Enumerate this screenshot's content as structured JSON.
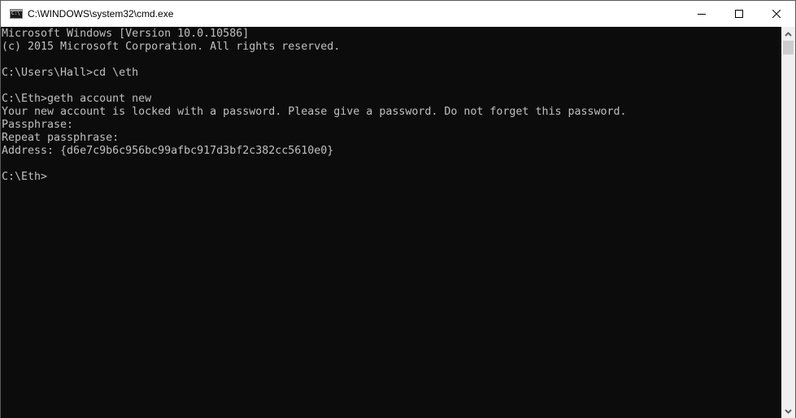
{
  "window": {
    "title": "C:\\WINDOWS\\system32\\cmd.exe",
    "icon": "cmd-icon",
    "controls": {
      "minimize": "minimize-icon",
      "maximize": "maximize-icon",
      "close": "close-icon"
    }
  },
  "console": {
    "lines": [
      "Microsoft Windows [Version 10.0.10586]",
      "(c) 2015 Microsoft Corporation. All rights reserved.",
      "",
      "C:\\Users\\Hall>cd \\eth",
      "",
      "C:\\Eth>geth account new",
      "Your new account is locked with a password. Please give a password. Do not forget this password.",
      "Passphrase:",
      "Repeat passphrase:",
      "Address: {d6e7c9b6c956bc99afbc917d3bf2c382cc5610e0}",
      "",
      "C:\\Eth>"
    ]
  },
  "scrollbar": {
    "up": "chevron-up-icon",
    "down": "chevron-down-icon"
  }
}
